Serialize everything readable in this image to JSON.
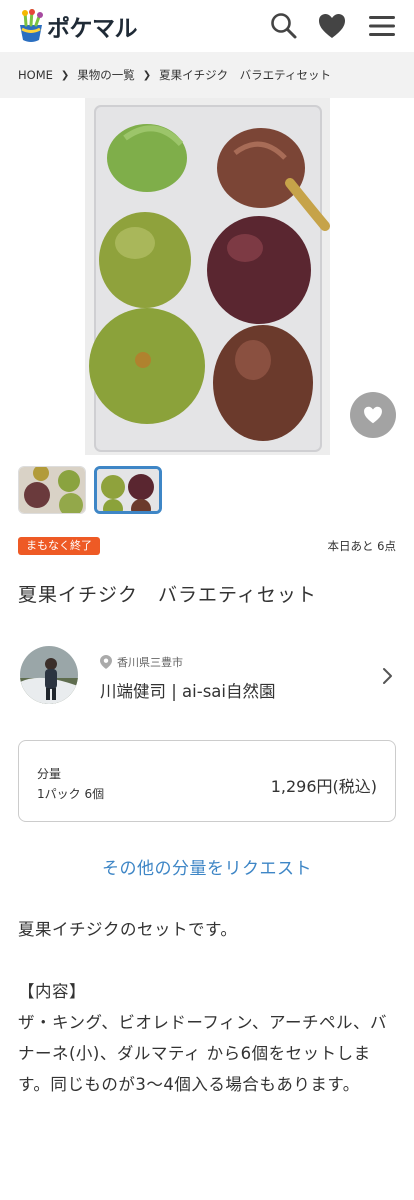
{
  "header": {
    "logo_text": "ポケマル",
    "icons": [
      "search-icon",
      "heart-icon",
      "menu-icon"
    ]
  },
  "breadcrumb": {
    "items": [
      "HOME",
      "果物の一覧",
      "夏果イチジク　バラエティセット"
    ]
  },
  "gallery": {
    "thumbnails": 2,
    "active_thumbnail": 2
  },
  "status": {
    "badge": "まもなく終了",
    "stock": "本日あと 6点"
  },
  "product": {
    "title": "夏果イチジク　バラエティセット"
  },
  "producer": {
    "location": "香川県三豊市",
    "name": "川端健司 | ai-sai自然園"
  },
  "price_card": {
    "label": "分量",
    "quantity": "1パック 6個",
    "price": "1,296円(税込)"
  },
  "request_link": "その他の分量をリクエスト",
  "description": "夏果イチジクのセットです。\n\n【内容】\nザ・キング、ビオレドーフィン、アーチペル、バナーネ(小)、ダルマティ から6個をセットします。同じものが3〜4個入る場合もあります。",
  "colors": {
    "accent_blue": "#3e86c6",
    "badge_orange": "#ee5a25",
    "breadcrumb_bg": "#f2f2f2"
  }
}
